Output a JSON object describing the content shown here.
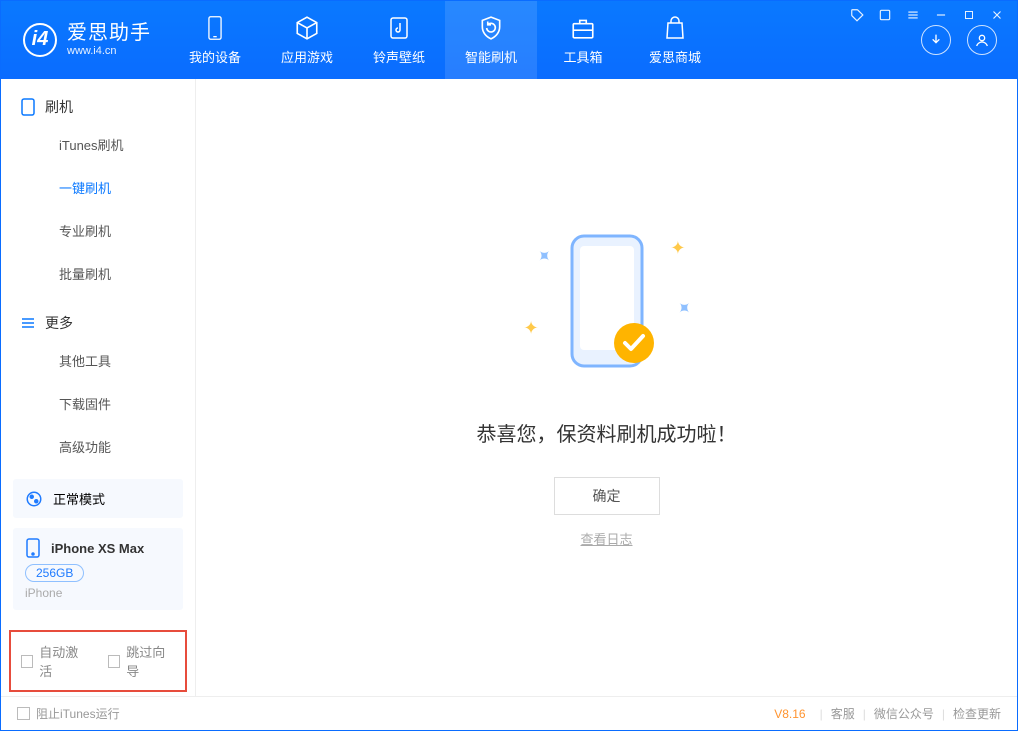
{
  "brand": {
    "title": "爱思助手",
    "subtitle": "www.i4.cn"
  },
  "nav": {
    "mydevice": "我的设备",
    "apps": "应用游戏",
    "ringtones": "铃声壁纸",
    "flash": "智能刷机",
    "toolbox": "工具箱",
    "store": "爱思商城"
  },
  "sidebar": {
    "flash_head": "刷机",
    "items": {
      "itunes": "iTunes刷机",
      "oneclick": "一键刷机",
      "pro": "专业刷机",
      "batch": "批量刷机"
    },
    "more_head": "更多",
    "more": {
      "other": "其他工具",
      "firmware": "下载固件",
      "advanced": "高级功能"
    }
  },
  "mode_card": {
    "label": "正常模式"
  },
  "device_card": {
    "name": "iPhone XS Max",
    "storage": "256GB",
    "type": "iPhone"
  },
  "options": {
    "auto_activate": "自动激活",
    "skip_guide": "跳过向导"
  },
  "main": {
    "title": "恭喜您，保资料刷机成功啦！",
    "ok": "确定",
    "view_log": "查看日志"
  },
  "footer": {
    "block_itunes": "阻止iTunes运行",
    "version": "V8.16",
    "support": "客服",
    "wechat": "微信公众号",
    "update": "检查更新"
  }
}
